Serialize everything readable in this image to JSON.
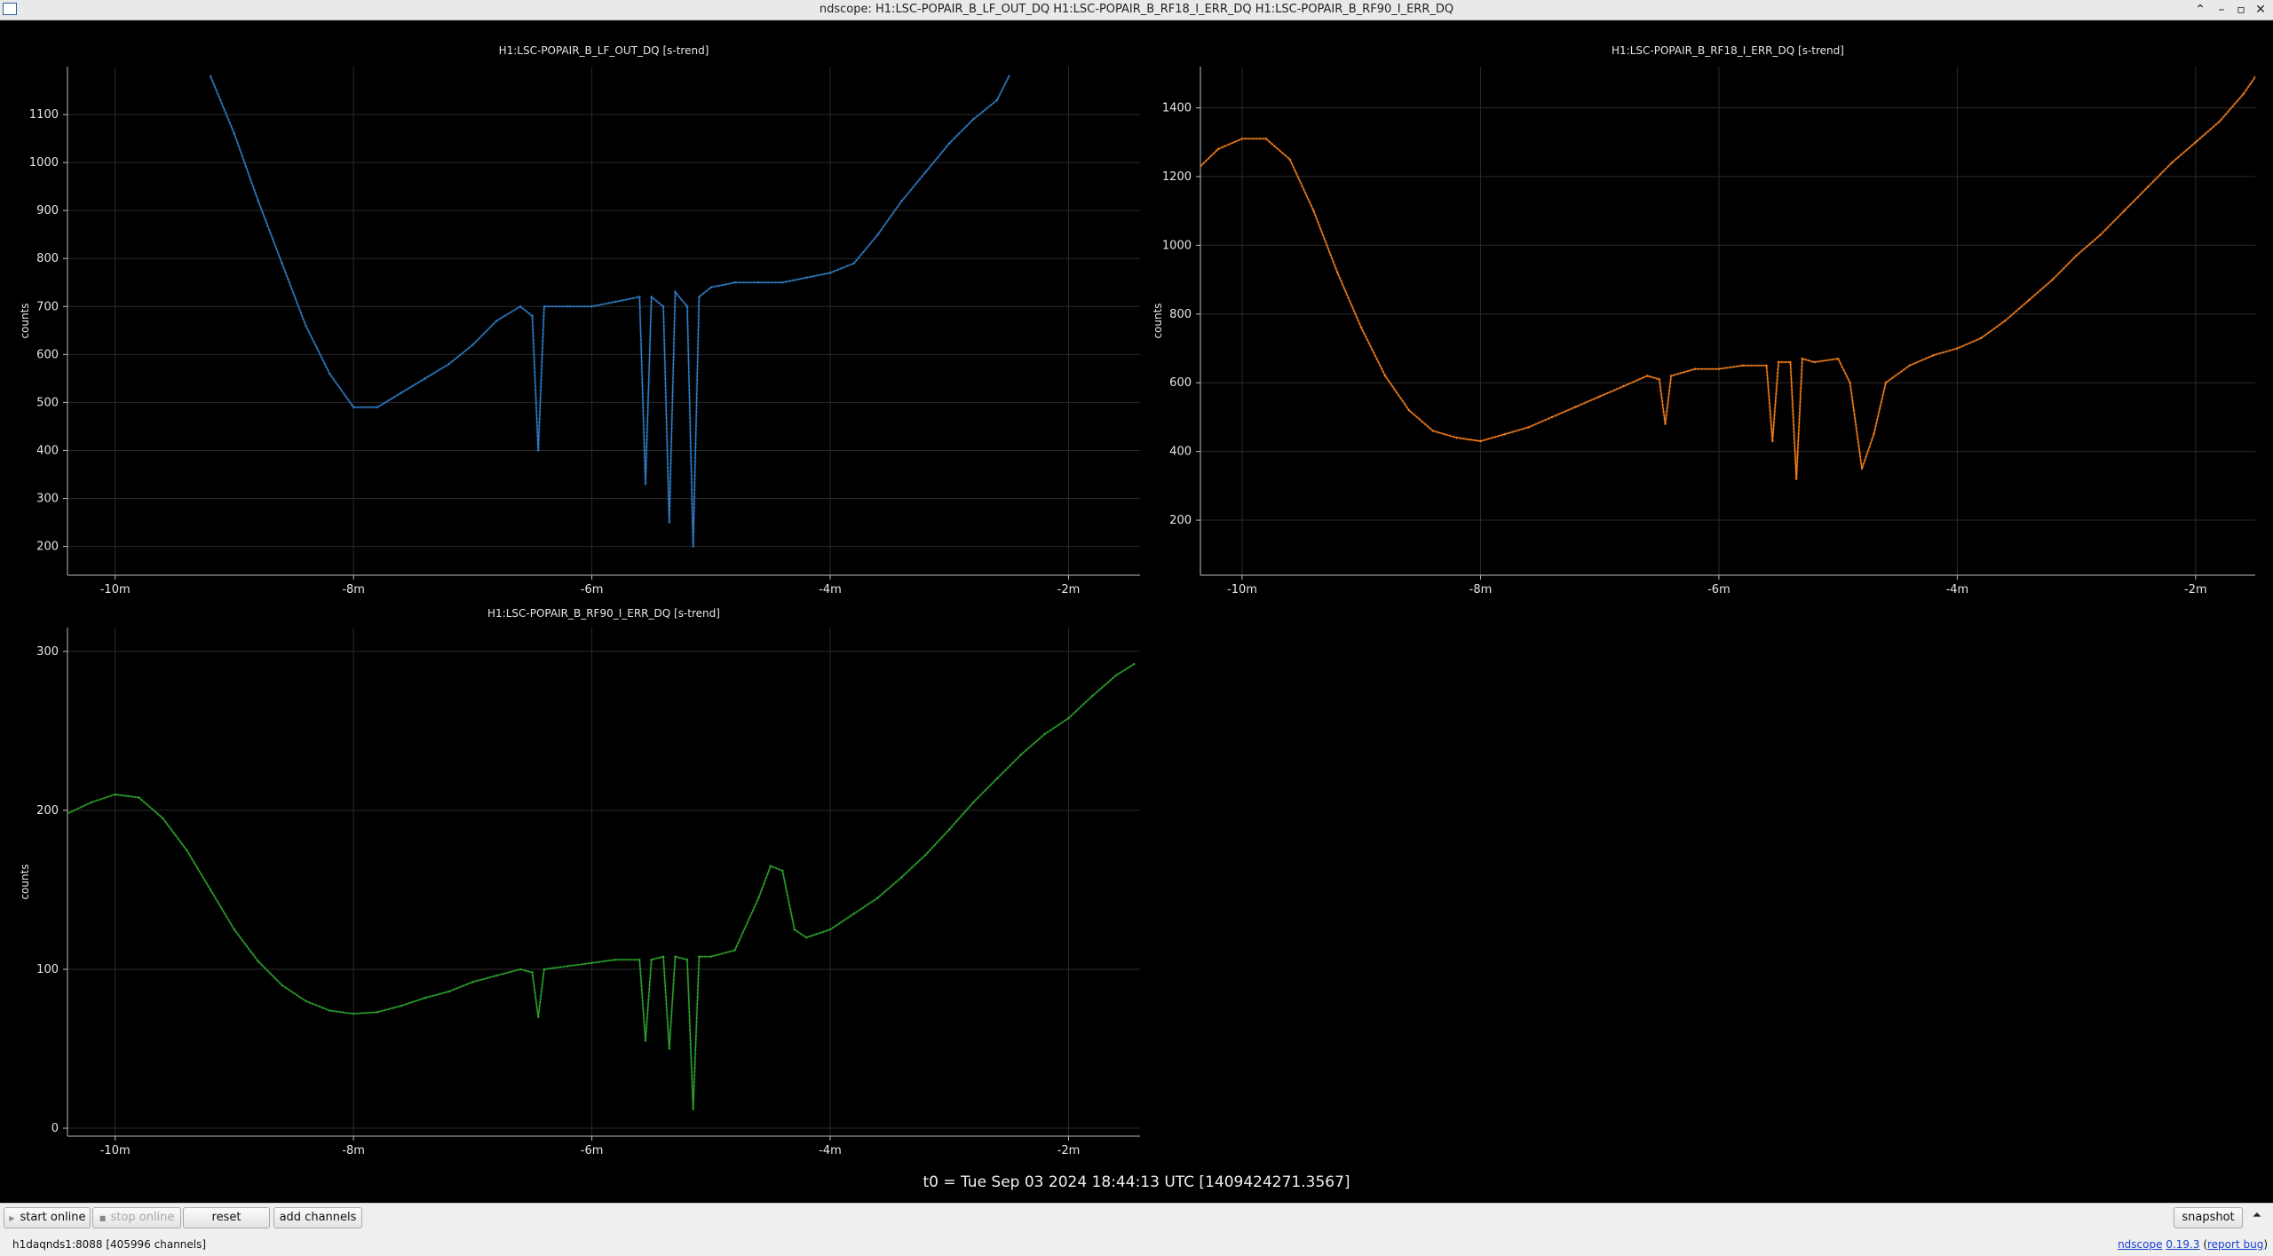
{
  "window": {
    "title": "ndscope: H1:LSC-POPAIR_B_LF_OUT_DQ H1:LSC-POPAIR_B_RF18_I_ERR_DQ H1:LSC-POPAIR_B_RF90_I_ERR_DQ",
    "buttons": [
      "⌃",
      "–",
      "▫",
      "✕"
    ]
  },
  "t0_label": "t0 = Tue Sep 03 2024 18:44:13 UTC [1409424271.3567]",
  "controls": {
    "start_online": "start online",
    "stop_online": "stop online",
    "reset": "reset",
    "add_channels": "add channels",
    "snapshot": "snapshot",
    "expand": "⏶"
  },
  "status": {
    "server": "h1daqnds1:8088  [405996 channels]",
    "app_name": "ndscope",
    "version": "0.19.3",
    "report_bug": "report bug"
  },
  "chart_data": [
    {
      "type": "line",
      "title": "H1:LSC-POPAIR_B_LF_OUT_DQ [s-trend]",
      "ylabel": "counts",
      "xlabel": "",
      "color": "#2e7cc4",
      "xlim": [
        -10.4,
        -1.4
      ],
      "ylim": [
        140,
        1200
      ],
      "xticks": [
        -10,
        -8,
        -6,
        -4,
        -2
      ],
      "xtick_labels": [
        "-10m",
        "-8m",
        "-6m",
        "-4m",
        "-2m"
      ],
      "yticks": [
        200,
        300,
        400,
        500,
        600,
        700,
        800,
        900,
        1000,
        1100
      ],
      "grid": true,
      "x": [
        -9.2,
        -9.0,
        -8.8,
        -8.6,
        -8.4,
        -8.2,
        -8.0,
        -7.8,
        -7.6,
        -7.4,
        -7.2,
        -7.0,
        -6.8,
        -6.6,
        -6.5,
        -6.45,
        -6.4,
        -6.2,
        -6.0,
        -5.8,
        -5.6,
        -5.55,
        -5.5,
        -5.4,
        -5.35,
        -5.3,
        -5.2,
        -5.15,
        -5.1,
        -5.0,
        -4.8,
        -4.6,
        -4.4,
        -4.2,
        -4.0,
        -3.8,
        -3.6,
        -3.4,
        -3.2,
        -3.0,
        -2.8,
        -2.6,
        -2.5
      ],
      "y": [
        1180,
        1060,
        920,
        790,
        660,
        560,
        490,
        490,
        520,
        550,
        580,
        620,
        670,
        700,
        680,
        400,
        700,
        700,
        700,
        710,
        720,
        330,
        720,
        700,
        250,
        730,
        700,
        200,
        720,
        740,
        750,
        750,
        750,
        760,
        770,
        790,
        850,
        920,
        980,
        1040,
        1090,
        1130,
        1180
      ]
    },
    {
      "type": "line",
      "title": "H1:LSC-POPAIR_B_RF18_I_ERR_DQ [s-trend]",
      "ylabel": "counts",
      "xlabel": "",
      "color": "#f07d1c",
      "xlim": [
        -10.35,
        -1.5
      ],
      "ylim": [
        40,
        1520
      ],
      "xticks": [
        -10,
        -8,
        -6,
        -4,
        -2
      ],
      "xtick_labels": [
        "-10m",
        "-8m",
        "-6m",
        "-4m",
        "-2m"
      ],
      "yticks": [
        200,
        400,
        600,
        800,
        1000,
        1200,
        1400
      ],
      "grid": true,
      "x": [
        -10.35,
        -10.2,
        -10.0,
        -9.8,
        -9.6,
        -9.4,
        -9.2,
        -9.0,
        -8.8,
        -8.6,
        -8.4,
        -8.2,
        -8.0,
        -7.8,
        -7.6,
        -7.4,
        -7.2,
        -7.0,
        -6.8,
        -6.6,
        -6.5,
        -6.45,
        -6.4,
        -6.2,
        -6.0,
        -5.8,
        -5.6,
        -5.55,
        -5.5,
        -5.4,
        -5.35,
        -5.3,
        -5.2,
        -5.0,
        -4.9,
        -4.8,
        -4.7,
        -4.6,
        -4.4,
        -4.2,
        -4.0,
        -3.8,
        -3.6,
        -3.4,
        -3.2,
        -3.0,
        -2.8,
        -2.6,
        -2.4,
        -2.2,
        -2.0,
        -1.8,
        -1.6,
        -1.5
      ],
      "y": [
        1230,
        1280,
        1310,
        1310,
        1250,
        1100,
        920,
        760,
        620,
        520,
        460,
        440,
        430,
        450,
        470,
        500,
        530,
        560,
        590,
        620,
        610,
        480,
        620,
        640,
        640,
        650,
        650,
        430,
        660,
        660,
        320,
        670,
        660,
        670,
        600,
        350,
        450,
        600,
        650,
        680,
        700,
        730,
        780,
        840,
        900,
        970,
        1030,
        1100,
        1170,
        1240,
        1300,
        1360,
        1440,
        1490
      ]
    },
    {
      "type": "line",
      "title": "H1:LSC-POPAIR_B_RF90_I_ERR_DQ [s-trend]",
      "ylabel": "counts",
      "xlabel": "",
      "color": "#2ca02c",
      "xlim": [
        -10.4,
        -1.4
      ],
      "ylim": [
        -5,
        315
      ],
      "xticks": [
        -10,
        -8,
        -6,
        -4,
        -2
      ],
      "xtick_labels": [
        "-10m",
        "-8m",
        "-6m",
        "-4m",
        "-2m"
      ],
      "yticks": [
        0,
        100,
        200,
        300
      ],
      "grid": true,
      "x": [
        -10.4,
        -10.2,
        -10.0,
        -9.8,
        -9.6,
        -9.4,
        -9.2,
        -9.0,
        -8.8,
        -8.6,
        -8.4,
        -8.2,
        -8.0,
        -7.8,
        -7.6,
        -7.4,
        -7.2,
        -7.0,
        -6.8,
        -6.6,
        -6.5,
        -6.45,
        -6.4,
        -6.2,
        -6.0,
        -5.8,
        -5.6,
        -5.55,
        -5.5,
        -5.4,
        -5.35,
        -5.3,
        -5.2,
        -5.15,
        -5.1,
        -5.0,
        -4.8,
        -4.6,
        -4.5,
        -4.4,
        -4.3,
        -4.2,
        -4.0,
        -3.8,
        -3.6,
        -3.4,
        -3.2,
        -3.0,
        -2.8,
        -2.6,
        -2.4,
        -2.2,
        -2.0,
        -1.8,
        -1.6,
        -1.45
      ],
      "y": [
        198,
        205,
        210,
        208,
        195,
        175,
        150,
        125,
        105,
        90,
        80,
        74,
        72,
        73,
        77,
        82,
        86,
        92,
        96,
        100,
        98,
        70,
        100,
        102,
        104,
        106,
        106,
        55,
        106,
        108,
        50,
        108,
        106,
        12,
        108,
        108,
        112,
        145,
        165,
        162,
        125,
        120,
        125,
        135,
        145,
        158,
        172,
        188,
        205,
        220,
        235,
        248,
        258,
        272,
        285,
        292
      ]
    }
  ]
}
